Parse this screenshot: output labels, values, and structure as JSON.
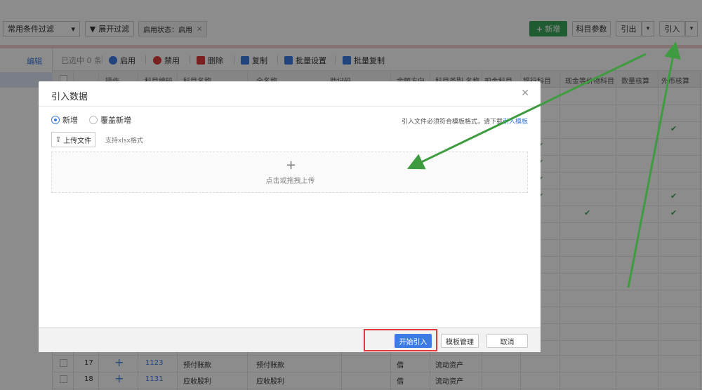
{
  "topbar": {
    "filter_select": "常用条件过滤",
    "expand_filter": "展开过滤",
    "status_tag": "启用状态：启用",
    "btn_new": "新增",
    "btn_subject_params": "科目参数",
    "btn_export": "引出",
    "btn_import": "引入"
  },
  "leftnav": {
    "edit": "编辑"
  },
  "actionbar": {
    "selected": "已选中 0 条",
    "enable": "启用",
    "disable": "禁用",
    "delete": "删除",
    "copy": "复制",
    "batch_settings": "批量设置",
    "batch_copy": "批量复制"
  },
  "table": {
    "headers": [
      "操作",
      "科目编码",
      "科目名称",
      "全名称",
      "助记码",
      "余额方向",
      "科目类别 名称",
      "现金科目",
      "银行科目",
      "现金等价物科目",
      "数量核算",
      "外币核算"
    ],
    "rows": [
      {
        "no": "17",
        "code": "1123",
        "name": "预付账款",
        "full": "预付账款",
        "dir": "借",
        "cat": "流动资产"
      },
      {
        "no": "18",
        "code": "1131",
        "name": "应收股利",
        "full": "应收股利",
        "dir": "借",
        "cat": "流动资产"
      }
    ]
  },
  "modal": {
    "title": "引入数据",
    "radio_new": "新增",
    "radio_overwrite": "覆盖新增",
    "hint_prefix": "引入文件必须符合模板格式，请下载",
    "hint_link": "引入模板",
    "upload_button": "上传文件",
    "format_hint": "支持xlsx格式",
    "dropzone_text": "点击或拖拽上传",
    "btn_start": "开始引入",
    "btn_template": "模板管理",
    "btn_cancel": "取消"
  },
  "colors": {
    "accent": "#3c7be5",
    "green": "#3aa85a",
    "highlight": "#e23a3a",
    "arrow": "#3f9b3f"
  }
}
